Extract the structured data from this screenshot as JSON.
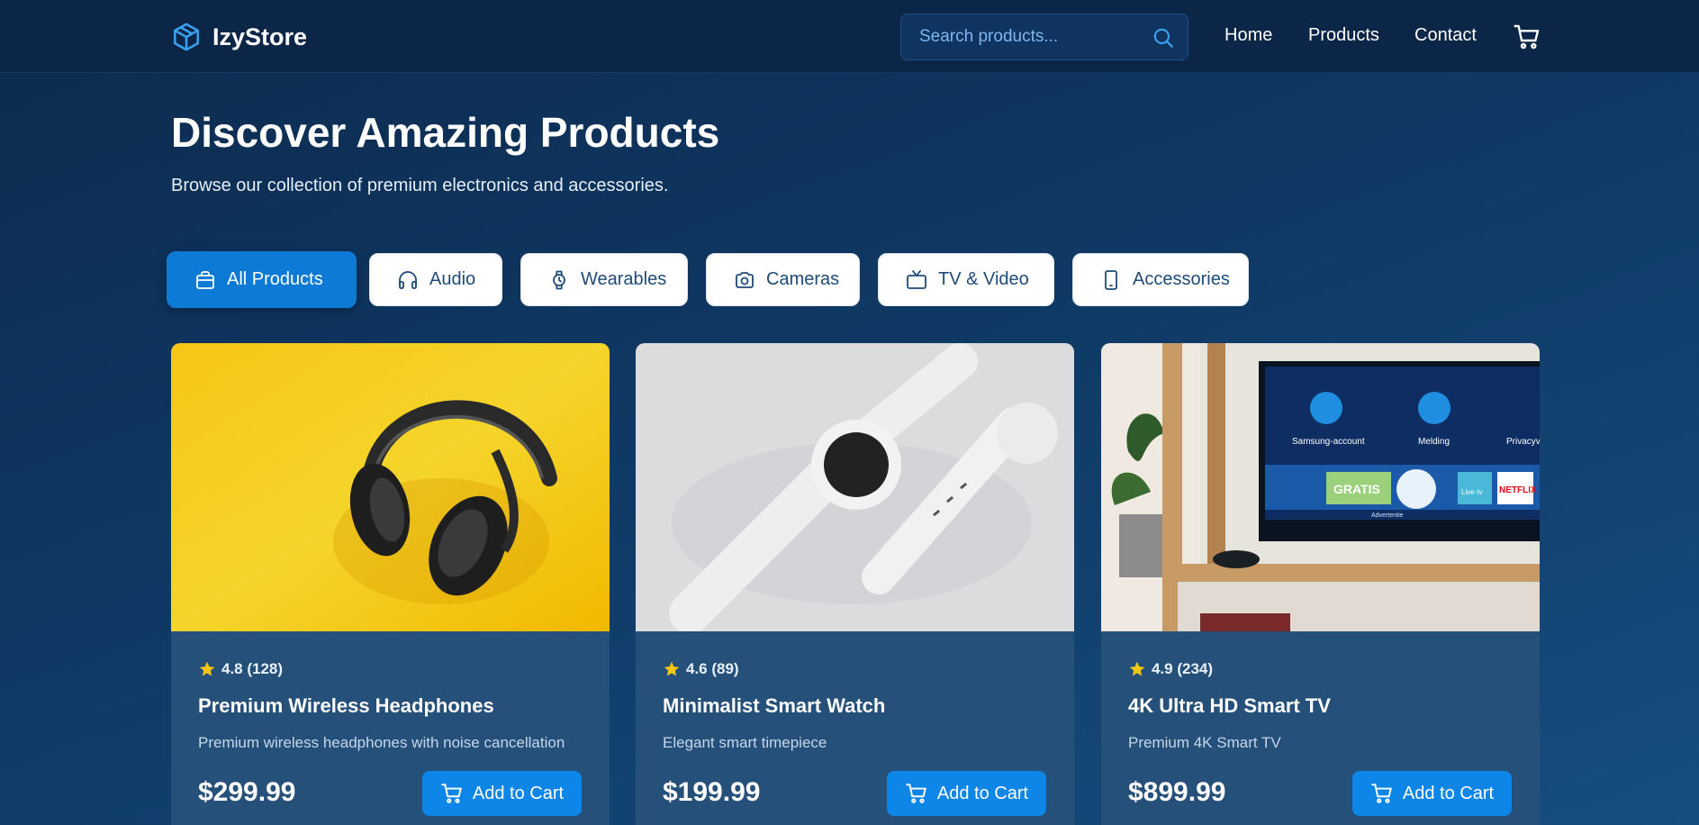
{
  "header": {
    "logo_text": "IzyStore",
    "search_placeholder": "Search products...",
    "nav": {
      "home": "Home",
      "products": "Products",
      "contact": "Contact"
    },
    "icons": {
      "logo": "box-icon",
      "search": "search-icon",
      "cart": "cart-icon"
    }
  },
  "hero": {
    "title": "Discover Amazing Products",
    "subtitle": "Browse our collection of premium electronics and accessories."
  },
  "categories": [
    {
      "label": "All Products",
      "icon": "bag-icon",
      "active": true
    },
    {
      "label": "Audio",
      "icon": "headphones-icon",
      "active": false
    },
    {
      "label": "Wearables",
      "icon": "watch-icon",
      "active": false
    },
    {
      "label": "Cameras",
      "icon": "camera-icon",
      "active": false
    },
    {
      "label": "TV & Video",
      "icon": "tv-icon",
      "active": false
    },
    {
      "label": "Accessories",
      "icon": "phone-icon",
      "active": false
    }
  ],
  "products": [
    {
      "rating": "4.8 (128)",
      "title": "Premium Wireless Headphones",
      "description": "Premium wireless headphones with noise cancellation",
      "price": "$299.99",
      "button": "Add to Cart",
      "image": "headphones-photo"
    },
    {
      "rating": "4.6 (89)",
      "title": "Minimalist Smart Watch",
      "description": "Elegant smart timepiece",
      "price": "$199.99",
      "button": "Add to Cart",
      "image": "smartwatch-photo"
    },
    {
      "rating": "4.9 (234)",
      "title": "4K Ultra HD Smart TV",
      "description": "Premium 4K Smart TV",
      "price": "$899.99",
      "button": "Add to Cart",
      "image": "smart-tv-photo"
    }
  ],
  "tv_screen": {
    "account": "Samsung-account",
    "notice": "Melding",
    "privacy": "Privacyv",
    "promo": "GRATIS",
    "promo_caption": "Advertentie",
    "tile": "Live-tv",
    "brand": "NETFLIX"
  },
  "colors": {
    "accent": "#0d86e8",
    "active_pill": "#0d7ad6",
    "header_bg": "#0b2646",
    "card_bg": "#25507a",
    "star": "#f5c518"
  }
}
